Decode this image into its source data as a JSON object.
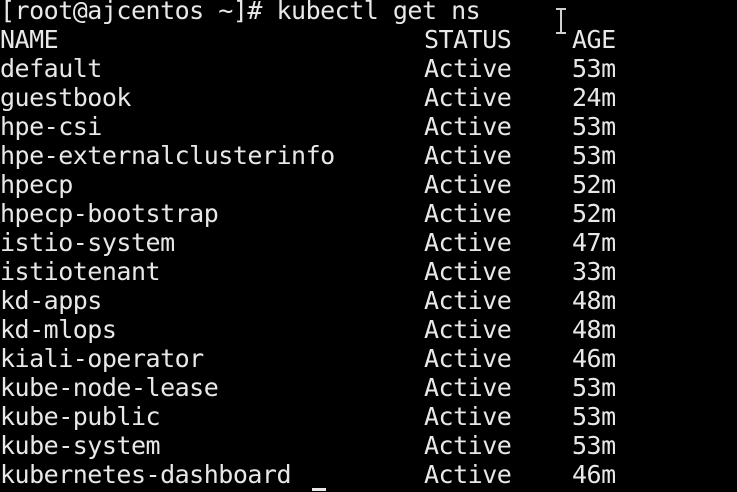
{
  "terminal": {
    "prompt": "[root@ajcentos ~]# kubectl get ns",
    "headers": {
      "name": "NAME",
      "status": "STATUS",
      "age": "AGE"
    },
    "rows": [
      {
        "name": "default",
        "status": "Active",
        "age": "53m"
      },
      {
        "name": "guestbook",
        "status": "Active",
        "age": "24m"
      },
      {
        "name": "hpe-csi",
        "status": "Active",
        "age": "53m"
      },
      {
        "name": "hpe-externalclusterinfo",
        "status": "Active",
        "age": "53m"
      },
      {
        "name": "hpecp",
        "status": "Active",
        "age": "52m"
      },
      {
        "name": "hpecp-bootstrap",
        "status": "Active",
        "age": "52m"
      },
      {
        "name": "istio-system",
        "status": "Active",
        "age": "47m"
      },
      {
        "name": "istiotenant",
        "status": "Active",
        "age": "33m"
      },
      {
        "name": "kd-apps",
        "status": "Active",
        "age": "48m"
      },
      {
        "name": "kd-mlops",
        "status": "Active",
        "age": "48m"
      },
      {
        "name": "kiali-operator",
        "status": "Active",
        "age": "46m"
      },
      {
        "name": "kube-node-lease",
        "status": "Active",
        "age": "53m"
      },
      {
        "name": "kube-public",
        "status": "Active",
        "age": "53m"
      },
      {
        "name": "kube-system",
        "status": "Active",
        "age": "53m"
      },
      {
        "name": "kubernetes-dashboard",
        "status": "Active",
        "age": "46m"
      }
    ],
    "colors": {
      "background": "#000000",
      "foreground": "#e8e8e8"
    },
    "icons": {
      "mouse_pointer": "text-cursor-ibeam-icon"
    }
  }
}
